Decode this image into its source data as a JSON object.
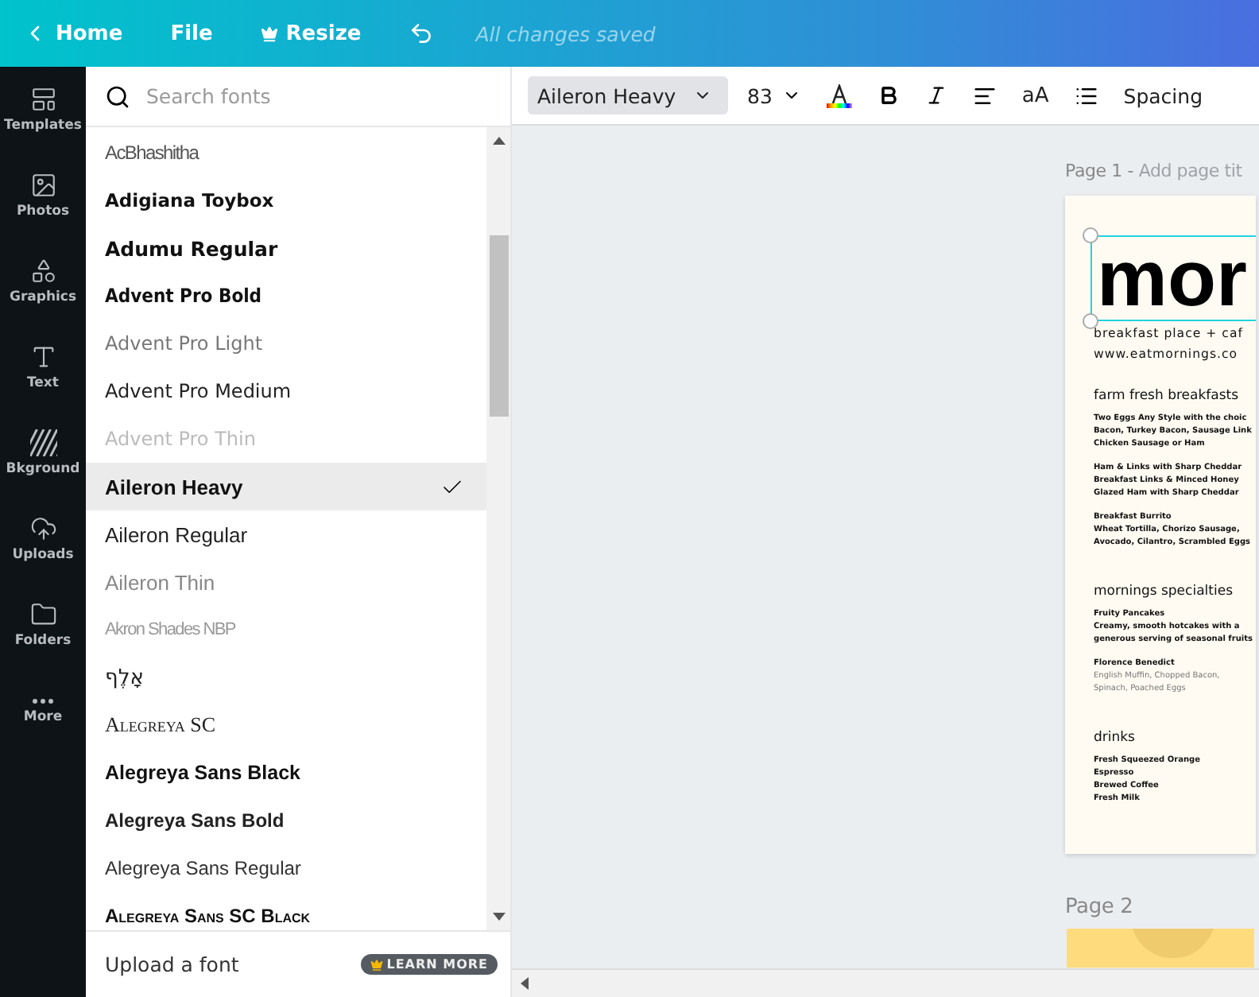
{
  "topbar": {
    "back": "Home",
    "menu": [
      "File",
      "Resize"
    ],
    "status": "All changes saved"
  },
  "sidebar": {
    "items": [
      {
        "label": "Templates"
      },
      {
        "label": "Photos"
      },
      {
        "label": "Graphics"
      },
      {
        "label": "Text"
      },
      {
        "label": "Bkground"
      },
      {
        "label": "Uploads"
      },
      {
        "label": "Folders"
      },
      {
        "label": "More"
      }
    ]
  },
  "font_panel": {
    "search": {
      "placeholder": "Search fonts"
    },
    "fonts": [
      {
        "name": "AcBhashitha",
        "kind": "hairline",
        "selected": false
      },
      {
        "name": "Adigiana Toybox",
        "kind": "display",
        "selected": false
      },
      {
        "name": "Adumu Regular",
        "kind": "heavy",
        "selected": false
      },
      {
        "name": "Advent Pro Bold",
        "kind": "condensed-bold",
        "selected": false
      },
      {
        "name": "Advent Pro Light",
        "kind": "condensed-light",
        "selected": false
      },
      {
        "name": "Advent Pro Medium",
        "kind": "condensed-medium",
        "selected": false
      },
      {
        "name": "Advent Pro Thin",
        "kind": "condensed-thin",
        "selected": false
      },
      {
        "name": "Aileron Heavy",
        "kind": "sans-heavy",
        "selected": true
      },
      {
        "name": "Aileron Regular",
        "kind": "sans-regular",
        "selected": false
      },
      {
        "name": "Aileron Thin",
        "kind": "sans-thin",
        "selected": false
      },
      {
        "name": "Akron Shades NBP",
        "kind": "shaded",
        "selected": false
      },
      {
        "name": "אָלֶף",
        "kind": "hebrew",
        "selected": false
      },
      {
        "name": "Alegreya SC",
        "kind": "serif-caps",
        "selected": false
      },
      {
        "name": "Alegreya Sans Black",
        "kind": "humanist-black",
        "selected": false
      },
      {
        "name": "Alegreya Sans Bold",
        "kind": "humanist-bold",
        "selected": false
      },
      {
        "name": "Alegreya Sans Regular",
        "kind": "humanist-regular",
        "selected": false
      },
      {
        "name": "Alegreya Sans SC Black",
        "kind": "humanist-caps",
        "selected": false
      }
    ],
    "upload": "Upload a font",
    "learn_more": "LEARN MORE"
  },
  "toolbar": {
    "font": "Aileron Heavy",
    "size": "83",
    "case": "aA",
    "spacing": "Spacing"
  },
  "pages": [
    {
      "label": "Page 1",
      "separator": "-",
      "title_placeholder": "Add page tit",
      "heading": "mor",
      "lines": [
        {
          "text": "breakfast place + caf",
          "kind": "tagline"
        },
        {
          "text": "www.eatmornings.co",
          "kind": "tagline"
        },
        {
          "text": "farm fresh breakfasts",
          "kind": "section"
        },
        {
          "text": "Two Eggs Any Style with the choic",
          "kind": "item"
        },
        {
          "text": "Bacon, Turkey Bacon, Sausage Link",
          "kind": "item"
        },
        {
          "text": "Chicken Sausage or Ham",
          "kind": "item-end"
        },
        {
          "text": "Ham & Links with Sharp Cheddar",
          "kind": "item"
        },
        {
          "text": "Breakfast Links & Minced Honey",
          "kind": "item"
        },
        {
          "text": "Glazed Ham with Sharp Cheddar",
          "kind": "item-end"
        },
        {
          "text": "Breakfast Burrito",
          "kind": "item"
        },
        {
          "text": "Wheat Tortilla, Chorizo Sausage,",
          "kind": "item"
        },
        {
          "text": "Avocado, Cilantro, Scrambled Eggs",
          "kind": "item-end"
        },
        {
          "text": "mornings specialties",
          "kind": "section"
        },
        {
          "text": "Fruity Pancakes",
          "kind": "item"
        },
        {
          "text": "Creamy, smooth hotcakes with a",
          "kind": "item"
        },
        {
          "text": "generous serving of seasonal fruits",
          "kind": "item-end"
        },
        {
          "text": "Florence Benedict",
          "kind": "item"
        },
        {
          "text": "English Muffin, Chopped Bacon,",
          "kind": "muted"
        },
        {
          "text": "Spinach, Poached Eggs",
          "kind": "muted-end"
        },
        {
          "text": "drinks",
          "kind": "section"
        },
        {
          "text": "Fresh Squeezed Orange",
          "kind": "item"
        },
        {
          "text": "Espresso",
          "kind": "item"
        },
        {
          "text": "Brewed Coffee",
          "kind": "item"
        },
        {
          "text": "Fresh Milk",
          "kind": "item"
        }
      ]
    },
    {
      "label": "Page 2"
    }
  ]
}
